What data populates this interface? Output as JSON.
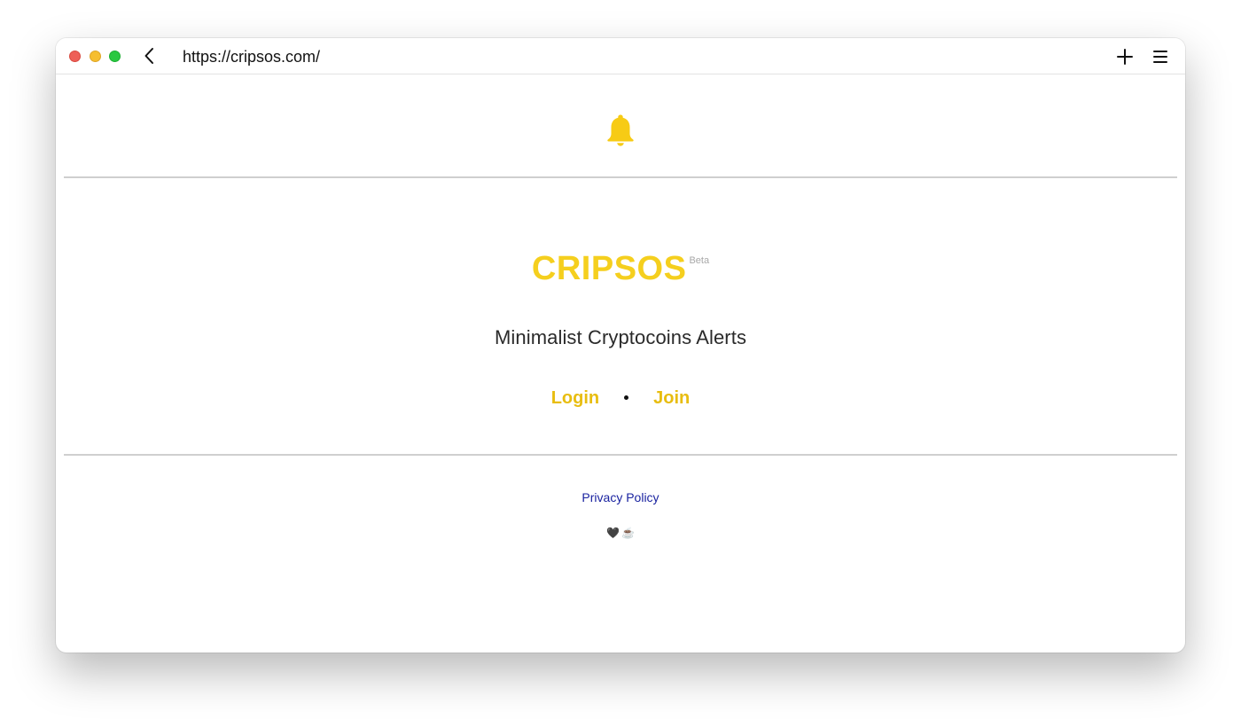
{
  "browser": {
    "url": "https://cripsos.com/",
    "icons": {
      "close": "red-traffic-light",
      "minimize": "yellow-traffic-light",
      "maximize": "green-traffic-light",
      "back": "chevron-left-icon",
      "new_tab": "plus-icon",
      "menu": "hamburger-icon"
    }
  },
  "header": {
    "logo_icon": "bell-icon",
    "logo_color": "#F7CB15"
  },
  "hero": {
    "brand_name": "CRIPSOS",
    "brand_badge": "Beta",
    "tagline": "Minimalist Cryptocoins Alerts",
    "login_label": "Login",
    "join_label": "Join",
    "accent_color": "#F5CF1E"
  },
  "footer": {
    "privacy_label": "Privacy Policy",
    "heart_glyph": "🖤",
    "coffee_glyph": "☕"
  }
}
